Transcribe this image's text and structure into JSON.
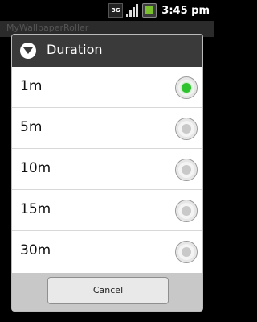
{
  "status_bar": {
    "network_label": "3G",
    "time": "3:45 pm"
  },
  "app_bar": {
    "title": "MyWallpaperRoller"
  },
  "dialog": {
    "title": "Duration",
    "options": [
      {
        "label": "1m",
        "selected": true
      },
      {
        "label": "5m",
        "selected": false
      },
      {
        "label": "10m",
        "selected": false
      },
      {
        "label": "15m",
        "selected": false
      },
      {
        "label": "30m",
        "selected": false
      }
    ],
    "cancel_label": "Cancel"
  }
}
